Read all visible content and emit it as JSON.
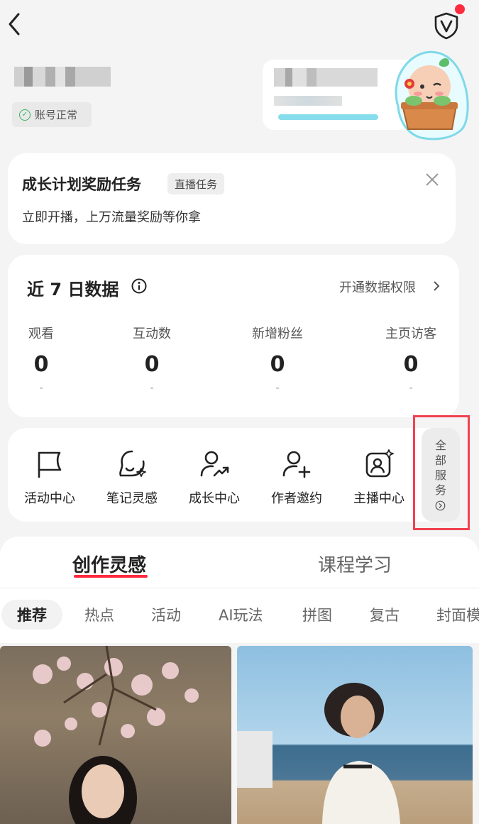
{
  "status": {
    "account_status": "账号正常"
  },
  "task": {
    "title": "成长计划奖励任务",
    "tag": "直播任务",
    "subtitle": "立即开播，上万流量奖励等你拿"
  },
  "data_panel": {
    "title": "近 7 日数据",
    "link": "开通数据权限",
    "metrics": [
      {
        "label": "观看",
        "value": "0",
        "change": "-"
      },
      {
        "label": "互动数",
        "value": "0",
        "change": "-"
      },
      {
        "label": "新增粉丝",
        "value": "0",
        "change": "-"
      },
      {
        "label": "主页访客",
        "value": "0",
        "change": "-"
      }
    ]
  },
  "services": {
    "items": [
      {
        "label": "活动中心",
        "icon": "flag-icon"
      },
      {
        "label": "笔记灵感",
        "icon": "bulb-icon"
      },
      {
        "label": "成长中心",
        "icon": "user-growth-icon"
      },
      {
        "label": "作者邀约",
        "icon": "user-add-icon"
      },
      {
        "label": "主播中心",
        "icon": "anchor-icon"
      }
    ],
    "all_label": "全部服务"
  },
  "tabs": {
    "items": [
      {
        "label": "创作灵感",
        "active": true
      },
      {
        "label": "课程学习",
        "active": false
      }
    ]
  },
  "chips": [
    "推荐",
    "热点",
    "活动",
    "AI玩法",
    "拼图",
    "复古",
    "封面模"
  ],
  "colors": {
    "accent": "#ff2a3d",
    "highlight": "#f04150",
    "status_ok": "#3bb35b"
  }
}
